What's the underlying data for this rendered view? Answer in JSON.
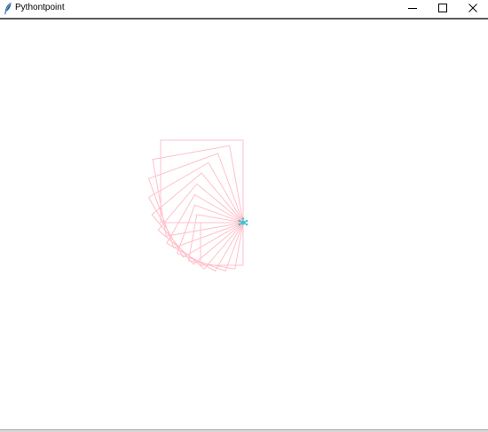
{
  "window": {
    "title": "Pythontpoint"
  },
  "icons": {
    "app": "feather-icon",
    "minimize": "minimize-icon",
    "maximize": "maximize-icon",
    "close": "close-icon"
  },
  "drawing": {
    "shape": "square",
    "square_count": 10,
    "rotation_step_deg": 10,
    "growth_step": 5,
    "stroke_color": "#ffc0cb",
    "turtle_color": "#40c4d0"
  }
}
